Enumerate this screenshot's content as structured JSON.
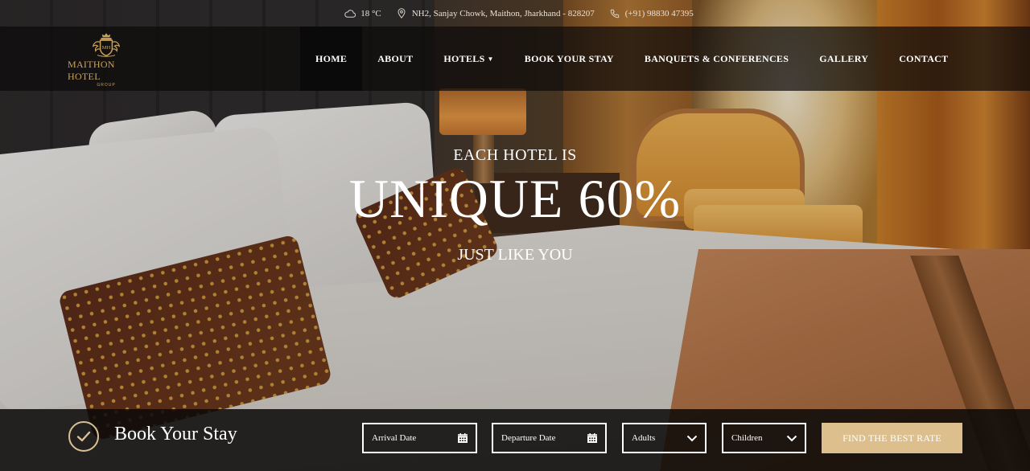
{
  "topbar": {
    "weather": "18 °C",
    "address": "NH2, Sanjay Chowk, Maithon, Jharkhand - 828207",
    "phone": "(+91) 98830 47395"
  },
  "logo": {
    "name": "MAITHON HOTEL",
    "sub": "GROUP"
  },
  "nav": {
    "items": [
      {
        "label": "HOME"
      },
      {
        "label": "ABOUT"
      },
      {
        "label": "HOTELS"
      },
      {
        "label": "BOOK YOUR STAY"
      },
      {
        "label": "BANQUETS & CONFERENCES"
      },
      {
        "label": "GALLERY"
      },
      {
        "label": "CONTACT"
      }
    ],
    "active_index": 0
  },
  "hero": {
    "eyebrow": "EACH HOTEL IS",
    "headline": "UNIQUE 60%",
    "tagline": "JUST LIKE YOU"
  },
  "booking": {
    "title": "Book Your Stay",
    "arrival": "Arrival Date",
    "departure": "Departure Date",
    "adults": "Adults",
    "children": "Children",
    "cta": "FIND THE BEST RATE"
  },
  "colors": {
    "accent": "#ddbf8d",
    "logo_gold": "#c9a25c",
    "nav_bg": "#0c0a0a"
  },
  "icons": [
    "cloud-icon",
    "location-pin-icon",
    "phone-icon",
    "check-circle-icon",
    "calendar-icon",
    "chevron-down-icon",
    "caret-down-icon"
  ]
}
